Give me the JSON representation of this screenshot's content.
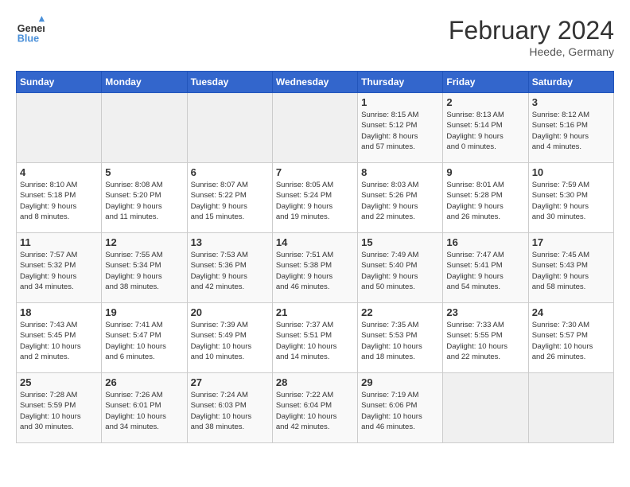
{
  "header": {
    "logo_line1": "General",
    "logo_line2": "Blue",
    "month_year": "February 2024",
    "location": "Heede, Germany"
  },
  "weekdays": [
    "Sunday",
    "Monday",
    "Tuesday",
    "Wednesday",
    "Thursday",
    "Friday",
    "Saturday"
  ],
  "weeks": [
    [
      {
        "day": "",
        "info": ""
      },
      {
        "day": "",
        "info": ""
      },
      {
        "day": "",
        "info": ""
      },
      {
        "day": "",
        "info": ""
      },
      {
        "day": "1",
        "info": "Sunrise: 8:15 AM\nSunset: 5:12 PM\nDaylight: 8 hours\nand 57 minutes."
      },
      {
        "day": "2",
        "info": "Sunrise: 8:13 AM\nSunset: 5:14 PM\nDaylight: 9 hours\nand 0 minutes."
      },
      {
        "day": "3",
        "info": "Sunrise: 8:12 AM\nSunset: 5:16 PM\nDaylight: 9 hours\nand 4 minutes."
      }
    ],
    [
      {
        "day": "4",
        "info": "Sunrise: 8:10 AM\nSunset: 5:18 PM\nDaylight: 9 hours\nand 8 minutes."
      },
      {
        "day": "5",
        "info": "Sunrise: 8:08 AM\nSunset: 5:20 PM\nDaylight: 9 hours\nand 11 minutes."
      },
      {
        "day": "6",
        "info": "Sunrise: 8:07 AM\nSunset: 5:22 PM\nDaylight: 9 hours\nand 15 minutes."
      },
      {
        "day": "7",
        "info": "Sunrise: 8:05 AM\nSunset: 5:24 PM\nDaylight: 9 hours\nand 19 minutes."
      },
      {
        "day": "8",
        "info": "Sunrise: 8:03 AM\nSunset: 5:26 PM\nDaylight: 9 hours\nand 22 minutes."
      },
      {
        "day": "9",
        "info": "Sunrise: 8:01 AM\nSunset: 5:28 PM\nDaylight: 9 hours\nand 26 minutes."
      },
      {
        "day": "10",
        "info": "Sunrise: 7:59 AM\nSunset: 5:30 PM\nDaylight: 9 hours\nand 30 minutes."
      }
    ],
    [
      {
        "day": "11",
        "info": "Sunrise: 7:57 AM\nSunset: 5:32 PM\nDaylight: 9 hours\nand 34 minutes."
      },
      {
        "day": "12",
        "info": "Sunrise: 7:55 AM\nSunset: 5:34 PM\nDaylight: 9 hours\nand 38 minutes."
      },
      {
        "day": "13",
        "info": "Sunrise: 7:53 AM\nSunset: 5:36 PM\nDaylight: 9 hours\nand 42 minutes."
      },
      {
        "day": "14",
        "info": "Sunrise: 7:51 AM\nSunset: 5:38 PM\nDaylight: 9 hours\nand 46 minutes."
      },
      {
        "day": "15",
        "info": "Sunrise: 7:49 AM\nSunset: 5:40 PM\nDaylight: 9 hours\nand 50 minutes."
      },
      {
        "day": "16",
        "info": "Sunrise: 7:47 AM\nSunset: 5:41 PM\nDaylight: 9 hours\nand 54 minutes."
      },
      {
        "day": "17",
        "info": "Sunrise: 7:45 AM\nSunset: 5:43 PM\nDaylight: 9 hours\nand 58 minutes."
      }
    ],
    [
      {
        "day": "18",
        "info": "Sunrise: 7:43 AM\nSunset: 5:45 PM\nDaylight: 10 hours\nand 2 minutes."
      },
      {
        "day": "19",
        "info": "Sunrise: 7:41 AM\nSunset: 5:47 PM\nDaylight: 10 hours\nand 6 minutes."
      },
      {
        "day": "20",
        "info": "Sunrise: 7:39 AM\nSunset: 5:49 PM\nDaylight: 10 hours\nand 10 minutes."
      },
      {
        "day": "21",
        "info": "Sunrise: 7:37 AM\nSunset: 5:51 PM\nDaylight: 10 hours\nand 14 minutes."
      },
      {
        "day": "22",
        "info": "Sunrise: 7:35 AM\nSunset: 5:53 PM\nDaylight: 10 hours\nand 18 minutes."
      },
      {
        "day": "23",
        "info": "Sunrise: 7:33 AM\nSunset: 5:55 PM\nDaylight: 10 hours\nand 22 minutes."
      },
      {
        "day": "24",
        "info": "Sunrise: 7:30 AM\nSunset: 5:57 PM\nDaylight: 10 hours\nand 26 minutes."
      }
    ],
    [
      {
        "day": "25",
        "info": "Sunrise: 7:28 AM\nSunset: 5:59 PM\nDaylight: 10 hours\nand 30 minutes."
      },
      {
        "day": "26",
        "info": "Sunrise: 7:26 AM\nSunset: 6:01 PM\nDaylight: 10 hours\nand 34 minutes."
      },
      {
        "day": "27",
        "info": "Sunrise: 7:24 AM\nSunset: 6:03 PM\nDaylight: 10 hours\nand 38 minutes."
      },
      {
        "day": "28",
        "info": "Sunrise: 7:22 AM\nSunset: 6:04 PM\nDaylight: 10 hours\nand 42 minutes."
      },
      {
        "day": "29",
        "info": "Sunrise: 7:19 AM\nSunset: 6:06 PM\nDaylight: 10 hours\nand 46 minutes."
      },
      {
        "day": "",
        "info": ""
      },
      {
        "day": "",
        "info": ""
      }
    ]
  ]
}
